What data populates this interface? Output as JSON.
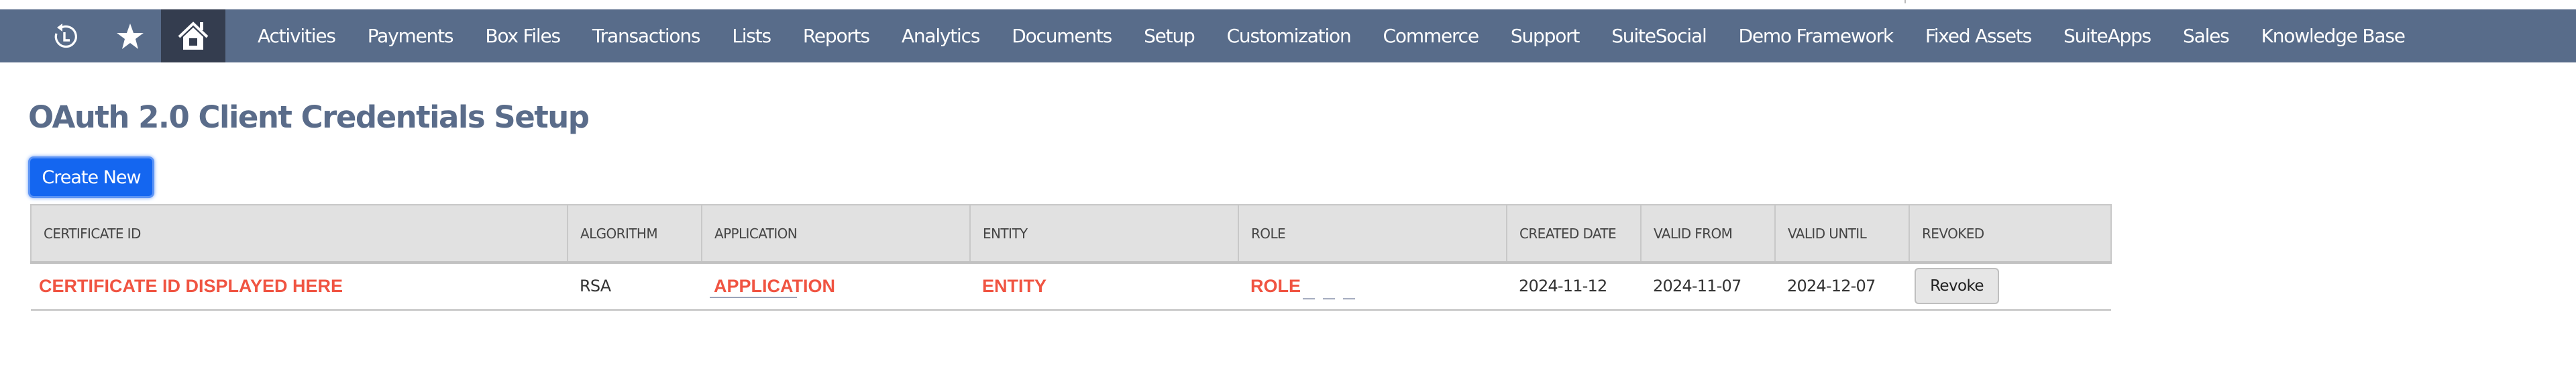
{
  "navbar": {
    "icons": {
      "recent": "recent-records-icon",
      "favorites": "star-icon",
      "home": "home-icon"
    },
    "items": [
      {
        "label": "Activities"
      },
      {
        "label": "Payments"
      },
      {
        "label": "Box Files"
      },
      {
        "label": "Transactions"
      },
      {
        "label": "Lists"
      },
      {
        "label": "Reports"
      },
      {
        "label": "Analytics"
      },
      {
        "label": "Documents"
      },
      {
        "label": "Setup"
      },
      {
        "label": "Customization"
      },
      {
        "label": "Commerce"
      },
      {
        "label": "Support"
      },
      {
        "label": "SuiteSocial"
      },
      {
        "label": "Demo Framework"
      },
      {
        "label": "Fixed Assets"
      },
      {
        "label": "SuiteApps"
      },
      {
        "label": "Sales"
      },
      {
        "label": "Knowledge Base"
      }
    ],
    "colors": {
      "background": "#586c8a",
      "active": "#343d4f"
    }
  },
  "page": {
    "title": "OAuth 2.0 Client Credentials Setup",
    "create_button": "Create New"
  },
  "table": {
    "columns": [
      "CERTIFICATE ID",
      "ALGORITHM",
      "APPLICATION",
      "ENTITY",
      "ROLE",
      "CREATED DATE",
      "VALID FROM",
      "VALID UNTIL",
      "REVOKED"
    ],
    "rows": [
      {
        "certificate_id": "CERTIFICATE ID DISPLAYED HERE",
        "algorithm": "RSA",
        "application": "APPLICATION",
        "entity": "ENTITY",
        "role": "ROLE",
        "created_date": "2024-11-12",
        "valid_from": "2024-11-07",
        "valid_until": "2024-12-07",
        "revoke_label": "Revoke"
      }
    ]
  },
  "colors": {
    "title": "#5a6c8a",
    "primary_button": "#1466f0",
    "placeholder_red": "#f05442"
  }
}
